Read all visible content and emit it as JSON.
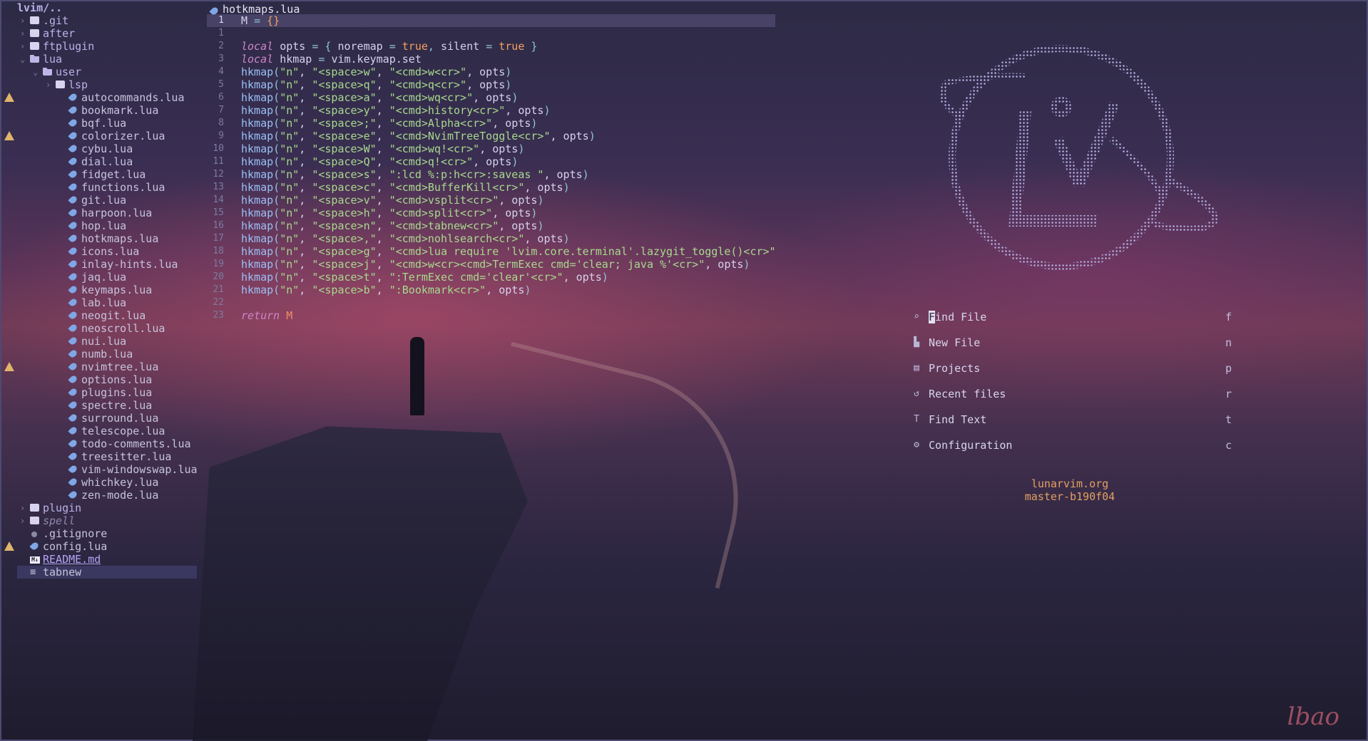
{
  "explorer": {
    "root": "lvim/..",
    "items": [
      {
        "label": ".git",
        "type": "folder",
        "depth": 0,
        "open": false,
        "warn": false
      },
      {
        "label": "after",
        "type": "folder",
        "depth": 0,
        "open": false,
        "warn": false
      },
      {
        "label": "ftplugin",
        "type": "folder",
        "depth": 0,
        "open": false,
        "warn": false
      },
      {
        "label": "lua",
        "type": "folder",
        "depth": 0,
        "open": true,
        "warn": false
      },
      {
        "label": "user",
        "type": "folder",
        "depth": 1,
        "open": true,
        "warn": false
      },
      {
        "label": "lsp",
        "type": "folder",
        "depth": 2,
        "open": false,
        "warn": false
      },
      {
        "label": "autocommands.lua",
        "type": "lua",
        "depth": 3,
        "warn": true
      },
      {
        "label": "bookmark.lua",
        "type": "lua",
        "depth": 3,
        "warn": false
      },
      {
        "label": "bqf.lua",
        "type": "lua",
        "depth": 3,
        "warn": false
      },
      {
        "label": "colorizer.lua",
        "type": "lua",
        "depth": 3,
        "warn": true
      },
      {
        "label": "cybu.lua",
        "type": "lua",
        "depth": 3,
        "warn": false
      },
      {
        "label": "dial.lua",
        "type": "lua",
        "depth": 3,
        "warn": false
      },
      {
        "label": "fidget.lua",
        "type": "lua",
        "depth": 3,
        "warn": false
      },
      {
        "label": "functions.lua",
        "type": "lua",
        "depth": 3,
        "warn": false
      },
      {
        "label": "git.lua",
        "type": "lua",
        "depth": 3,
        "warn": false
      },
      {
        "label": "harpoon.lua",
        "type": "lua",
        "depth": 3,
        "warn": false
      },
      {
        "label": "hop.lua",
        "type": "lua",
        "depth": 3,
        "warn": false
      },
      {
        "label": "hotkmaps.lua",
        "type": "lua",
        "depth": 3,
        "warn": false
      },
      {
        "label": "icons.lua",
        "type": "lua",
        "depth": 3,
        "warn": false
      },
      {
        "label": "inlay-hints.lua",
        "type": "lua",
        "depth": 3,
        "warn": false
      },
      {
        "label": "jaq.lua",
        "type": "lua",
        "depth": 3,
        "warn": false
      },
      {
        "label": "keymaps.lua",
        "type": "lua",
        "depth": 3,
        "warn": false
      },
      {
        "label": "lab.lua",
        "type": "lua",
        "depth": 3,
        "warn": false
      },
      {
        "label": "neogit.lua",
        "type": "lua",
        "depth": 3,
        "warn": false
      },
      {
        "label": "neoscroll.lua",
        "type": "lua",
        "depth": 3,
        "warn": false
      },
      {
        "label": "nui.lua",
        "type": "lua",
        "depth": 3,
        "warn": false
      },
      {
        "label": "numb.lua",
        "type": "lua",
        "depth": 3,
        "warn": false
      },
      {
        "label": "nvimtree.lua",
        "type": "lua",
        "depth": 3,
        "warn": true
      },
      {
        "label": "options.lua",
        "type": "lua",
        "depth": 3,
        "warn": false
      },
      {
        "label": "plugins.lua",
        "type": "lua",
        "depth": 3,
        "warn": false
      },
      {
        "label": "spectre.lua",
        "type": "lua",
        "depth": 3,
        "warn": false
      },
      {
        "label": "surround.lua",
        "type": "lua",
        "depth": 3,
        "warn": false
      },
      {
        "label": "telescope.lua",
        "type": "lua",
        "depth": 3,
        "warn": false
      },
      {
        "label": "todo-comments.lua",
        "type": "lua",
        "depth": 3,
        "warn": false
      },
      {
        "label": "treesitter.lua",
        "type": "lua",
        "depth": 3,
        "warn": false
      },
      {
        "label": "vim-windowswap.lua",
        "type": "lua",
        "depth": 3,
        "warn": false
      },
      {
        "label": "whichkey.lua",
        "type": "lua",
        "depth": 3,
        "warn": false
      },
      {
        "label": "zen-mode.lua",
        "type": "lua",
        "depth": 3,
        "warn": false
      },
      {
        "label": "plugin",
        "type": "folder",
        "depth": 0,
        "open": false,
        "warn": false
      },
      {
        "label": "spell",
        "type": "folder",
        "depth": 0,
        "open": false,
        "warn": false,
        "muted": true
      },
      {
        "label": ".gitignore",
        "type": "dot",
        "depth": 0,
        "warn": false
      },
      {
        "label": "config.lua",
        "type": "lua",
        "depth": 0,
        "warn": true
      },
      {
        "label": "README.md",
        "type": "md",
        "depth": 0,
        "warn": false,
        "link": true
      },
      {
        "label": "tabnew",
        "type": "lines",
        "depth": 0,
        "warn": false,
        "selected": true
      }
    ]
  },
  "editor": {
    "filename": "hotkmaps.lua",
    "lines": [
      {
        "n": "1",
        "current": true,
        "t": [
          [
            "var",
            "M "
          ],
          [
            "op",
            "= "
          ],
          [
            "bool",
            "{}"
          ]
        ]
      },
      {
        "n": "1",
        "t": []
      },
      {
        "n": "2",
        "t": [
          [
            "kw",
            "local "
          ],
          [
            "var",
            "opts "
          ],
          [
            "op",
            "= { "
          ],
          [
            "var",
            "noremap "
          ],
          [
            "op",
            "= "
          ],
          [
            "bool",
            "true"
          ],
          [
            "op",
            ", "
          ],
          [
            "var",
            "silent "
          ],
          [
            "op",
            "= "
          ],
          [
            "bool",
            "true"
          ],
          [
            "op",
            " }"
          ]
        ]
      },
      {
        "n": "3",
        "t": [
          [
            "kw",
            "local "
          ],
          [
            "var",
            "hkmap "
          ],
          [
            "op",
            "= "
          ],
          [
            "var",
            "vim.keymap.set"
          ]
        ]
      },
      {
        "n": "4",
        "t": [
          [
            "fn",
            "hkmap"
          ],
          [
            "op",
            "("
          ],
          [
            "str",
            "\"n\""
          ],
          [
            "var",
            ", "
          ],
          [
            "str",
            "\"<space>w\""
          ],
          [
            "var",
            ", "
          ],
          [
            "str",
            "\"<cmd>w<cr>\""
          ],
          [
            "var",
            ", opts"
          ],
          [
            "op",
            ")"
          ]
        ]
      },
      {
        "n": "5",
        "t": [
          [
            "fn",
            "hkmap"
          ],
          [
            "op",
            "("
          ],
          [
            "str",
            "\"n\""
          ],
          [
            "var",
            ", "
          ],
          [
            "str",
            "\"<space>q\""
          ],
          [
            "var",
            ", "
          ],
          [
            "str",
            "\"<cmd>q<cr>\""
          ],
          [
            "var",
            ", opts"
          ],
          [
            "op",
            ")"
          ]
        ]
      },
      {
        "n": "6",
        "t": [
          [
            "fn",
            "hkmap"
          ],
          [
            "op",
            "("
          ],
          [
            "str",
            "\"n\""
          ],
          [
            "var",
            ", "
          ],
          [
            "str",
            "\"<space>a\""
          ],
          [
            "var",
            ", "
          ],
          [
            "str",
            "\"<cmd>wq<cr>\""
          ],
          [
            "var",
            ", opts"
          ],
          [
            "op",
            ")"
          ]
        ]
      },
      {
        "n": "7",
        "t": [
          [
            "fn",
            "hkmap"
          ],
          [
            "op",
            "("
          ],
          [
            "str",
            "\"n\""
          ],
          [
            "var",
            ", "
          ],
          [
            "str",
            "\"<space>y\""
          ],
          [
            "var",
            ", "
          ],
          [
            "str",
            "\"<cmd>history<cr>\""
          ],
          [
            "var",
            ", opts"
          ],
          [
            "op",
            ")"
          ]
        ]
      },
      {
        "n": "8",
        "t": [
          [
            "fn",
            "hkmap"
          ],
          [
            "op",
            "("
          ],
          [
            "str",
            "\"n\""
          ],
          [
            "var",
            ", "
          ],
          [
            "str",
            "\"<space>;\""
          ],
          [
            "var",
            ", "
          ],
          [
            "str",
            "\"<cmd>Alpha<cr>\""
          ],
          [
            "var",
            ", opts"
          ],
          [
            "op",
            ")"
          ]
        ]
      },
      {
        "n": "9",
        "t": [
          [
            "fn",
            "hkmap"
          ],
          [
            "op",
            "("
          ],
          [
            "str",
            "\"n\""
          ],
          [
            "var",
            ", "
          ],
          [
            "str",
            "\"<space>e\""
          ],
          [
            "var",
            ", "
          ],
          [
            "str",
            "\"<cmd>NvimTreeToggle<cr>\""
          ],
          [
            "var",
            ", opts"
          ],
          [
            "op",
            ")"
          ]
        ]
      },
      {
        "n": "10",
        "t": [
          [
            "fn",
            "hkmap"
          ],
          [
            "op",
            "("
          ],
          [
            "str",
            "\"n\""
          ],
          [
            "var",
            ", "
          ],
          [
            "str",
            "\"<space>W\""
          ],
          [
            "var",
            ", "
          ],
          [
            "str",
            "\"<cmd>wq!<cr>\""
          ],
          [
            "var",
            ", opts"
          ],
          [
            "op",
            ")"
          ]
        ]
      },
      {
        "n": "11",
        "t": [
          [
            "fn",
            "hkmap"
          ],
          [
            "op",
            "("
          ],
          [
            "str",
            "\"n\""
          ],
          [
            "var",
            ", "
          ],
          [
            "str",
            "\"<space>Q\""
          ],
          [
            "var",
            ", "
          ],
          [
            "str",
            "\"<cmd>q!<cr>\""
          ],
          [
            "var",
            ", opts"
          ],
          [
            "op",
            ")"
          ]
        ]
      },
      {
        "n": "12",
        "t": [
          [
            "fn",
            "hkmap"
          ],
          [
            "op",
            "("
          ],
          [
            "str",
            "\"n\""
          ],
          [
            "var",
            ", "
          ],
          [
            "str",
            "\"<space>s\""
          ],
          [
            "var",
            ", "
          ],
          [
            "str",
            "\":lcd %:p:h<cr>:saveas \""
          ],
          [
            "var",
            ", opts"
          ],
          [
            "op",
            ")"
          ]
        ]
      },
      {
        "n": "13",
        "t": [
          [
            "fn",
            "hkmap"
          ],
          [
            "op",
            "("
          ],
          [
            "str",
            "\"n\""
          ],
          [
            "var",
            ", "
          ],
          [
            "str",
            "\"<space>c\""
          ],
          [
            "var",
            ", "
          ],
          [
            "str",
            "\"<cmd>BufferKill<cr>\""
          ],
          [
            "var",
            ", opts"
          ],
          [
            "op",
            ")"
          ]
        ]
      },
      {
        "n": "14",
        "t": [
          [
            "fn",
            "hkmap"
          ],
          [
            "op",
            "("
          ],
          [
            "str",
            "\"n\""
          ],
          [
            "var",
            ", "
          ],
          [
            "str",
            "\"<space>v\""
          ],
          [
            "var",
            ", "
          ],
          [
            "str",
            "\"<cmd>vsplit<cr>\""
          ],
          [
            "var",
            ", opts"
          ],
          [
            "op",
            ")"
          ]
        ]
      },
      {
        "n": "15",
        "t": [
          [
            "fn",
            "hkmap"
          ],
          [
            "op",
            "("
          ],
          [
            "str",
            "\"n\""
          ],
          [
            "var",
            ", "
          ],
          [
            "str",
            "\"<space>h\""
          ],
          [
            "var",
            ", "
          ],
          [
            "str",
            "\"<cmd>split<cr>\""
          ],
          [
            "var",
            ", opts"
          ],
          [
            "op",
            ")"
          ]
        ]
      },
      {
        "n": "16",
        "t": [
          [
            "fn",
            "hkmap"
          ],
          [
            "op",
            "("
          ],
          [
            "str",
            "\"n\""
          ],
          [
            "var",
            ", "
          ],
          [
            "str",
            "\"<space>n\""
          ],
          [
            "var",
            ", "
          ],
          [
            "str",
            "\"<cmd>tabnew<cr>\""
          ],
          [
            "var",
            ", opts"
          ],
          [
            "op",
            ")"
          ]
        ]
      },
      {
        "n": "17",
        "t": [
          [
            "fn",
            "hkmap"
          ],
          [
            "op",
            "("
          ],
          [
            "str",
            "\"n\""
          ],
          [
            "var",
            ", "
          ],
          [
            "str",
            "\"<space>,\""
          ],
          [
            "var",
            ", "
          ],
          [
            "str",
            "\"<cmd>nohlsearch<cr>\""
          ],
          [
            "var",
            ", opts"
          ],
          [
            "op",
            ")"
          ]
        ]
      },
      {
        "n": "18",
        "t": [
          [
            "fn",
            "hkmap"
          ],
          [
            "op",
            "("
          ],
          [
            "str",
            "\"n\""
          ],
          [
            "var",
            ", "
          ],
          [
            "str",
            "\"<space>g\""
          ],
          [
            "var",
            ", "
          ],
          [
            "str",
            "\"<cmd>lua require 'lvim.core.terminal'.lazygit_toggle()<cr>\""
          ]
        ]
      },
      {
        "n": "19",
        "t": [
          [
            "fn",
            "hkmap"
          ],
          [
            "op",
            "("
          ],
          [
            "str",
            "\"n\""
          ],
          [
            "var",
            ", "
          ],
          [
            "str",
            "\"<space>j\""
          ],
          [
            "var",
            ", "
          ],
          [
            "str",
            "\"<cmd>w<cr><cmd>TermExec cmd='clear; java %'<cr>\""
          ],
          [
            "var",
            ", opts"
          ],
          [
            "op",
            ")"
          ]
        ]
      },
      {
        "n": "20",
        "t": [
          [
            "fn",
            "hkmap"
          ],
          [
            "op",
            "("
          ],
          [
            "str",
            "\"n\""
          ],
          [
            "var",
            ", "
          ],
          [
            "str",
            "\"<space>t\""
          ],
          [
            "var",
            ", "
          ],
          [
            "str",
            "\":TermExec cmd='clear'<cr>\""
          ],
          [
            "var",
            ", opts"
          ],
          [
            "op",
            ")"
          ]
        ]
      },
      {
        "n": "21",
        "t": [
          [
            "fn",
            "hkmap"
          ],
          [
            "op",
            "("
          ],
          [
            "str",
            "\"n\""
          ],
          [
            "var",
            ", "
          ],
          [
            "str",
            "\"<space>b\""
          ],
          [
            "var",
            ", "
          ],
          [
            "str",
            "\":Bookmark<cr>\""
          ],
          [
            "var",
            ", opts"
          ],
          [
            "op",
            ")"
          ]
        ]
      },
      {
        "n": "22",
        "t": []
      },
      {
        "n": "23",
        "t": [
          [
            "kw",
            "return "
          ],
          [
            "ret",
            "M"
          ]
        ]
      }
    ]
  },
  "dashboard": {
    "items": [
      {
        "icon": "find-file-icon",
        "glyph": "⌕",
        "label": "Find File",
        "key": "f",
        "cursor": true
      },
      {
        "icon": "new-file-icon",
        "glyph": "▙",
        "label": "New File",
        "key": "n"
      },
      {
        "icon": "projects-icon",
        "glyph": "▤",
        "label": "Projects",
        "key": "p"
      },
      {
        "icon": "recent-files-icon",
        "glyph": "↺",
        "label": "Recent files",
        "key": "r"
      },
      {
        "icon": "find-text-icon",
        "glyph": "T",
        "label": "Find Text",
        "key": "t"
      },
      {
        "icon": "configuration-icon",
        "glyph": "⚙",
        "label": "Configuration",
        "key": "c"
      }
    ],
    "footer_site": "lunarvim.org",
    "footer_version": "master-b190f04"
  },
  "signature": "lbao",
  "colors": {
    "accent": "#b9b3e8",
    "string": "#a8d98d",
    "keyword": "#cd85c8",
    "boolean": "#f4a162",
    "footer": "#e3a060",
    "warning": "#e1b46b"
  }
}
